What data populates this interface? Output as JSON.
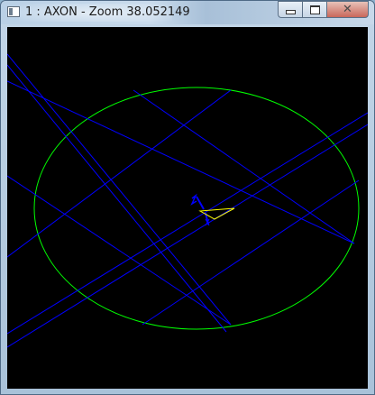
{
  "window": {
    "title": "1 : AXON - Zoom 38.052149",
    "icon": "app-window-icon",
    "buttons": {
      "minimize": "minimize-icon",
      "maximize": "maximize-icon",
      "close": "close-icon"
    }
  },
  "viewport": {
    "background": "#000000",
    "ellipse_color": "#00ff00",
    "line_color": "#0000ff",
    "axis_color": "#ffff00"
  }
}
